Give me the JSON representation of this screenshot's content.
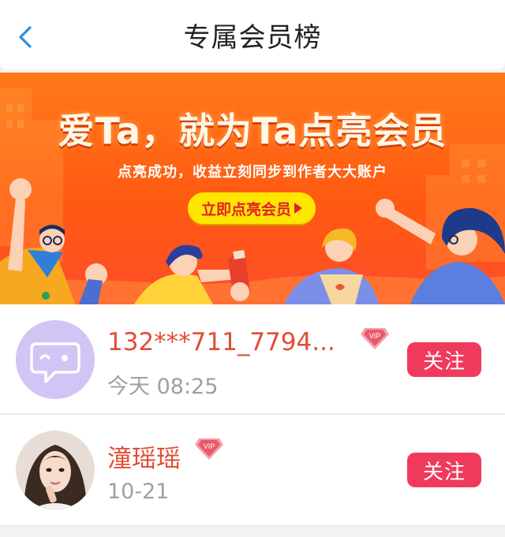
{
  "header": {
    "title": "专属会员榜",
    "back_icon": "chevron-left-icon"
  },
  "banner": {
    "headline": "爱Ta，就为Ta点亮会员",
    "subline": "点亮成功，收益立刻同步到作者大大账户",
    "cta_label": "立即点亮会员",
    "colors": {
      "background": "#ff6a1a",
      "cta": "#ffe600",
      "cta_text": "#e0202a"
    }
  },
  "members": [
    {
      "name": "132***711_7794...",
      "time": "今天 08:25",
      "vip_badge": "VIP",
      "follow_label": "关注",
      "avatar": "chat-bubble-avatar"
    },
    {
      "name": "潼瑶瑶",
      "time": "10-21",
      "vip_badge": "VIP",
      "follow_label": "关注",
      "avatar": "photo-avatar"
    }
  ],
  "colors": {
    "name": "#e24c35",
    "follow_button": "#f03a5c",
    "time": "#a0a0a0"
  }
}
